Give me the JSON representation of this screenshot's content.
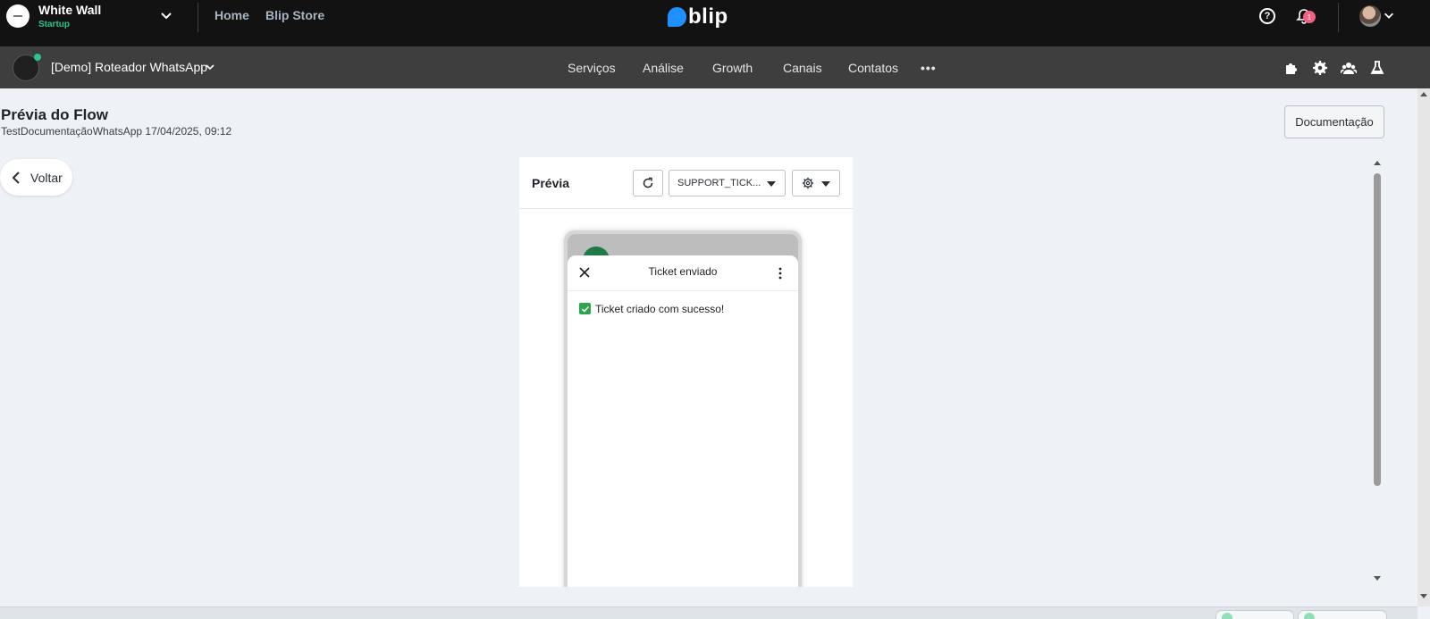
{
  "topbar": {
    "org_name": "White Wall",
    "org_plan": "Startup",
    "links": [
      "Home",
      "Blip Store"
    ],
    "brand": "blip",
    "notification_count": "1",
    "help_label": "?"
  },
  "subbar": {
    "bot_name": "[Demo] Roteador WhatsApp",
    "nav": [
      "Serviços",
      "Análise",
      "Growth",
      "Canais",
      "Contatos"
    ],
    "more_label": "•••",
    "icons": [
      "puzzle-icon",
      "gear-icon",
      "team-icon",
      "flask-icon"
    ]
  },
  "page": {
    "title": "Prévia do Flow",
    "subtitle": "TestDocumentaçãoWhatsApp 17/04/2025, 09:12",
    "doc_button": "Documentação",
    "back_label": "Voltar"
  },
  "preview": {
    "title": "Prévia",
    "screen_select": "SUPPORT_TICK...",
    "sheet_title": "Ticket enviado",
    "message": "Ticket criado com sucesso!"
  },
  "colors": {
    "topbar_bg": "#121212",
    "subbar_bg": "#3e3e3e",
    "accent_green": "#2fc48c",
    "brand_blue": "#1e90ff",
    "badge_pink": "#f06081",
    "page_bg": "#eef2f6"
  }
}
